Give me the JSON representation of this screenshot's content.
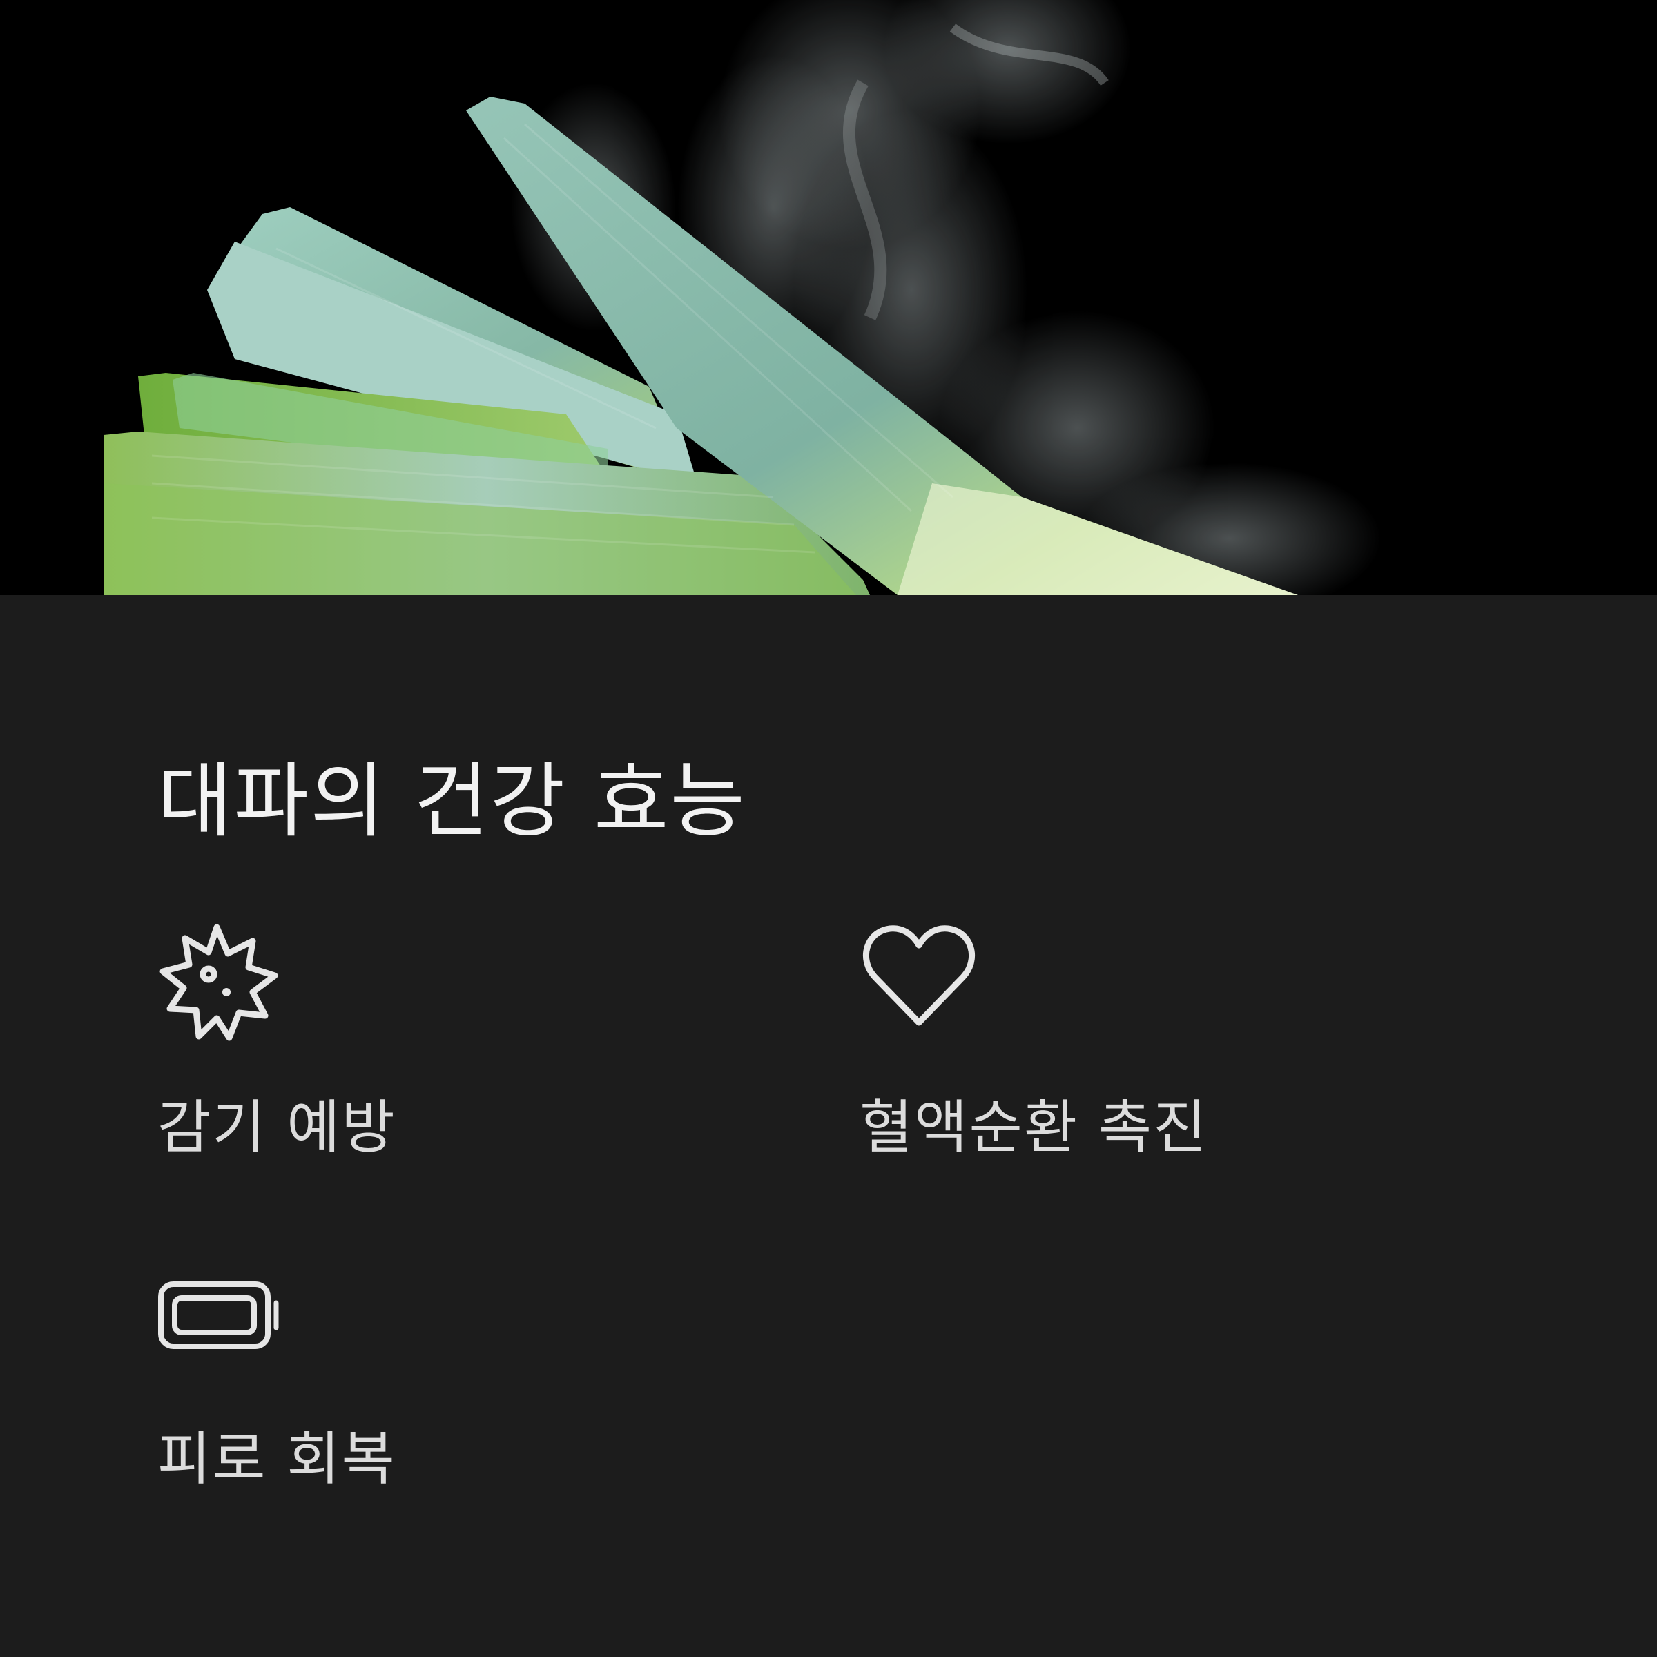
{
  "hero": {
    "image": "steaming-leek-photo",
    "background": "#000000"
  },
  "section": {
    "title": "대파의 건강 효능"
  },
  "benefits": [
    {
      "icon": "virus-icon",
      "label": "감기 예방"
    },
    {
      "icon": "heart-icon",
      "label": "혈액순환 촉진"
    },
    {
      "icon": "battery-icon",
      "label": "피로 회복"
    }
  ],
  "colors": {
    "panel": "#1c1c1c",
    "title_text": "#f2f2f2",
    "label_text": "#dcdcdc",
    "icon_stroke": "#e6e6e6"
  }
}
